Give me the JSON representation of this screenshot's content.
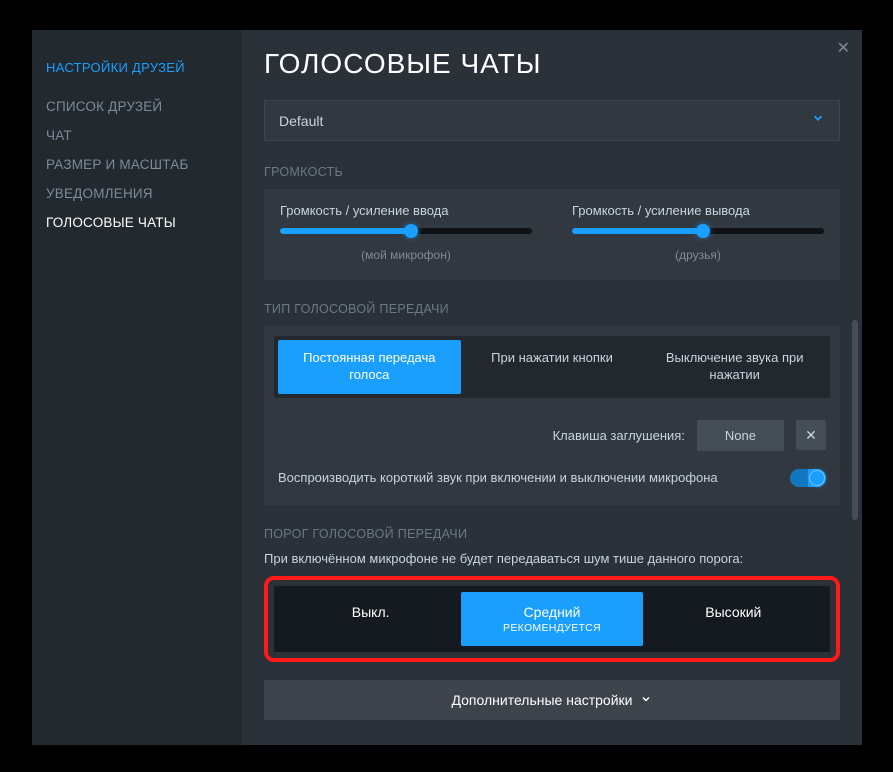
{
  "sidebar": {
    "title": "НАСТРОЙКИ ДРУЗЕЙ",
    "items": [
      {
        "label": "СПИСОК ДРУЗЕЙ"
      },
      {
        "label": "ЧАТ"
      },
      {
        "label": "РАЗМЕР И МАСШТАБ"
      },
      {
        "label": "УВЕДОМЛЕНИЯ"
      },
      {
        "label": "ГОЛОСОВЫЕ ЧАТЫ"
      }
    ]
  },
  "page_title": "ГОЛОСОВЫЕ ЧАТЫ",
  "device_dropdown": {
    "value": "Default"
  },
  "volume": {
    "section": "ГРОМКОСТЬ",
    "input": {
      "label": "Громкость / усиление ввода",
      "sub": "(мой микрофон)",
      "percent": 52
    },
    "output": {
      "label": "Громкость / усиление вывода",
      "sub": "(друзья)",
      "percent": 52
    }
  },
  "transmit": {
    "section": "ТИП ГОЛОСОВОЙ ПЕРЕДАЧИ",
    "options": [
      "Постоянная передача голоса",
      "При нажатии кнопки",
      "Выключение звука при нажатии"
    ],
    "mute_key_label": "Клавиша заглушения:",
    "mute_key_value": "None",
    "sound_toggle_label": "Воспроизводить короткий звук при включении и выключении микрофона"
  },
  "threshold": {
    "section": "ПОРОГ ГОЛОСОВОЙ ПЕРЕДАЧИ",
    "desc": "При включённом микрофоне не будет передаваться шум тише данного порога:",
    "options": [
      {
        "main": "Выкл."
      },
      {
        "main": "Средний",
        "sub": "РЕКОМЕНДУЕТСЯ"
      },
      {
        "main": "Высокий"
      }
    ]
  },
  "advanced_label": "Дополнительные настройки"
}
